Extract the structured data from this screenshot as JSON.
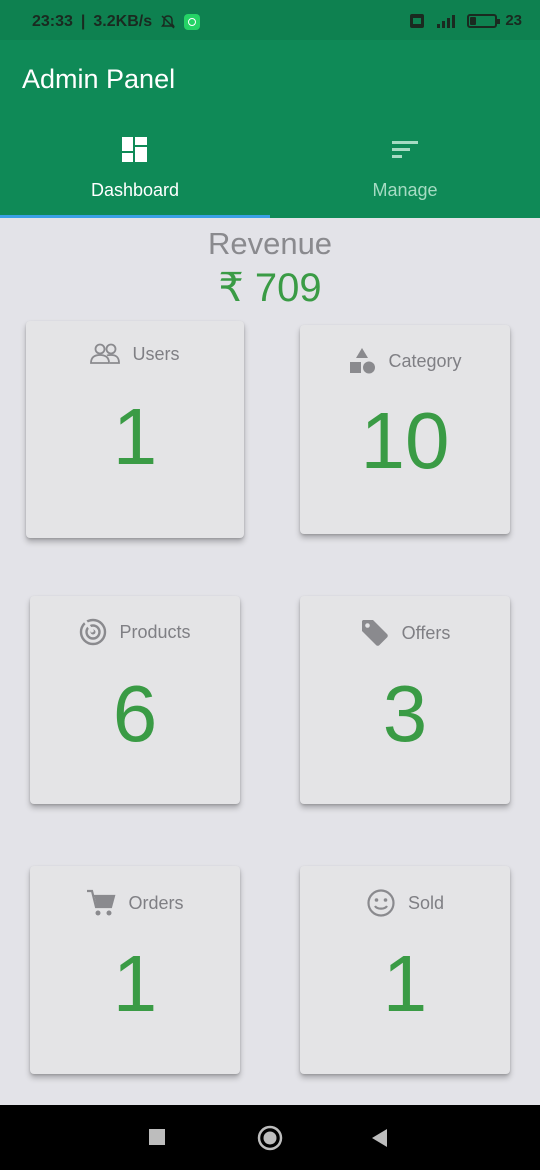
{
  "status_bar": {
    "time": "23:33",
    "speed": "3.2KB/s",
    "battery_pct": "23",
    "battery_level": 0.23,
    "network": "4G"
  },
  "header": {
    "title": "Admin Panel",
    "tabs": [
      {
        "label": "Dashboard",
        "icon": "dashboard-icon",
        "active": true
      },
      {
        "label": "Manage",
        "icon": "sort-icon",
        "active": false
      }
    ]
  },
  "revenue": {
    "title": "Revenue",
    "value": "₹ 709"
  },
  "cards": [
    {
      "label": "Users",
      "icon": "users-icon",
      "value": "1"
    },
    {
      "label": "Category",
      "icon": "category-icon",
      "value": "10"
    },
    {
      "label": "Products",
      "icon": "products-icon",
      "value": "6"
    },
    {
      "label": "Offers",
      "icon": "tag-icon",
      "value": "3"
    },
    {
      "label": "Orders",
      "icon": "cart-icon",
      "value": "1"
    },
    {
      "label": "Sold",
      "icon": "smiley-icon",
      "value": "1"
    }
  ],
  "colors": {
    "app_bar": "#0f8a57",
    "accent_green": "#3a9b45",
    "tab_indicator": "#3aa0e6",
    "background": "#e3e3e8"
  }
}
